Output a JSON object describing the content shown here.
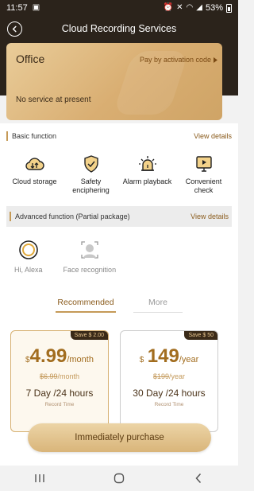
{
  "status_bar": {
    "time": "11:57",
    "battery": "53%"
  },
  "header": {
    "title": "Cloud Recording Services"
  },
  "office_card": {
    "name": "Office",
    "activation_link": "Pay by activation code",
    "status": "No service at present"
  },
  "basic_function": {
    "title": "Basic function",
    "details_link": "View details",
    "items": [
      {
        "label": "Cloud storage",
        "icon": "cloud-storage-icon"
      },
      {
        "label": "Safety enciphering",
        "icon": "shield-check-icon"
      },
      {
        "label": "Alarm playback",
        "icon": "alarm-light-icon"
      },
      {
        "label": "Convenient check",
        "icon": "monitor-play-icon"
      }
    ]
  },
  "advanced_function": {
    "title": "Advanced function (Partial package)",
    "details_link": "View details",
    "items": [
      {
        "label": "Hi, Alexa",
        "icon": "alexa-icon"
      },
      {
        "label": "Face recognition",
        "icon": "face-recognition-icon"
      }
    ]
  },
  "tabs": [
    {
      "label": "Recommended",
      "active": true
    },
    {
      "label": "More",
      "active": false
    }
  ],
  "plans": [
    {
      "save_badge": "Save $ 2.00",
      "currency": "$",
      "price": "4.99",
      "period": "/month",
      "original_price": "$6.99",
      "original_period": "/month",
      "duration": "7 Day /24 hours",
      "record_label": "Record Time",
      "selected": true
    },
    {
      "save_badge": "Save $ 50",
      "currency": "$",
      "price": "149",
      "period": "/year",
      "original_price": "$199",
      "original_period": "/year",
      "duration": "30 Day /24 hours",
      "record_label": "Record Time",
      "selected": false
    }
  ],
  "purchase_button": {
    "label": "Immediately purchase"
  },
  "colors": {
    "header_bg": "#2b231b",
    "gold_accent": "#c59a57",
    "price_text": "#a26d1f",
    "link_text": "#8a5b1c"
  }
}
